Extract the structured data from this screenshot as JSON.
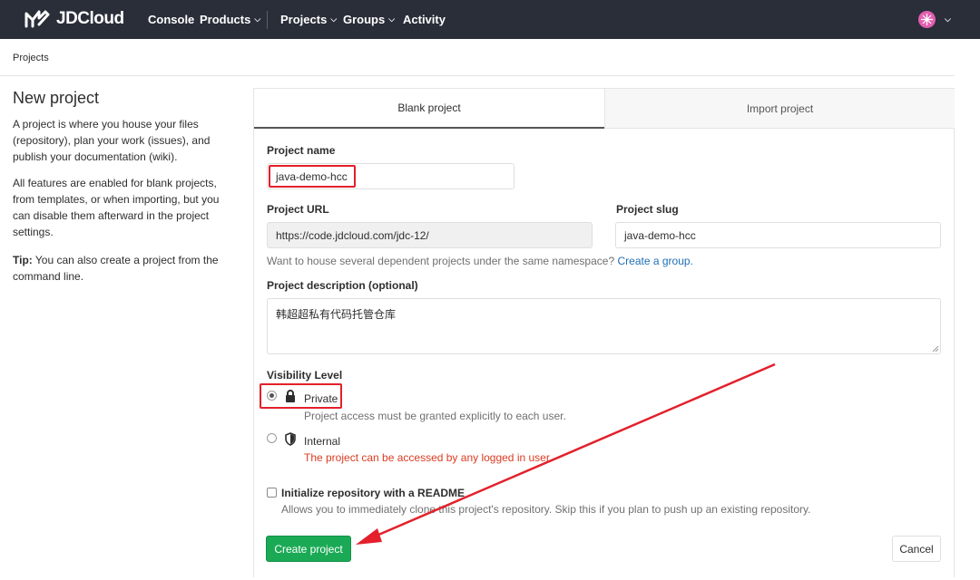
{
  "brand": {
    "name": "JDCloud"
  },
  "nav": {
    "console": "Console",
    "products": "Products",
    "projects": "Projects",
    "groups": "Groups",
    "activity": "Activity"
  },
  "breadcrumb": "Projects",
  "intro": {
    "title": "New project",
    "p1": "A project is where you house your files (repository), plan your work (issues), and publish your documentation (wiki).",
    "p2": "All features are enabled for blank projects, from templates, or when importing, but you can disable them afterward in the project settings.",
    "tip_label": "Tip:",
    "tip_text": " You can also create a project from the command line."
  },
  "tabs": {
    "blank": "Blank project",
    "import": "Import project"
  },
  "form": {
    "name_label": "Project name",
    "name_value": "java-demo-hcc",
    "url_label": "Project URL",
    "url_value": "https://code.jdcloud.com/jdc-12/",
    "slug_label": "Project slug",
    "slug_value": "java-demo-hcc",
    "namespace_help": "Want to house several dependent projects under the same namespace?",
    "namespace_link": "Create a group.",
    "desc_label": "Project description (optional)",
    "desc_value": "韩超超私有代码托管仓库",
    "visibility_label": "Visibility Level",
    "private_label": "Private",
    "private_desc": "Project access must be granted explicitly to each user.",
    "internal_label": "Internal",
    "internal_desc": "The project can be accessed by any logged in user.",
    "readme_label": "Initialize repository with a README",
    "readme_desc": "Allows you to immediately clone this project's repository. Skip this if you plan to push up an existing repository.",
    "create": "Create project",
    "cancel": "Cancel"
  },
  "colors": {
    "nav_bg": "#292e39",
    "create_btn": "#1aaa55",
    "highlight": "#e3202b",
    "warning_text": "#db3b21"
  },
  "icons": {
    "lock": "lock-icon",
    "internal": "shield-icon",
    "user": "avatar-icon"
  }
}
